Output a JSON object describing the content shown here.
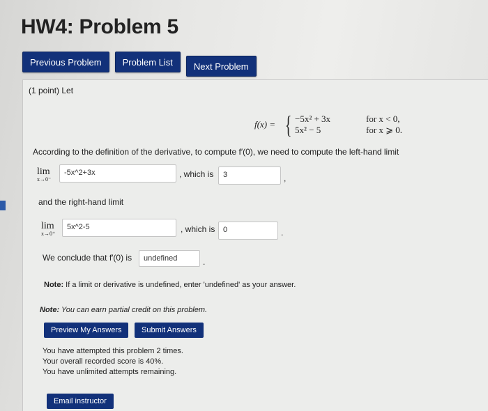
{
  "header": {
    "title": "HW4: Problem 5"
  },
  "nav": {
    "previous": "Previous Problem",
    "list": "Problem List",
    "next": "Next Problem"
  },
  "problem": {
    "points_label": "(1 point) Let",
    "function": {
      "lhs": "f(x) =",
      "piece1": "−5x² + 3x",
      "cond1": "for x < 0,",
      "piece2": "5x² − 5",
      "cond2": "for x ⩾ 0."
    },
    "instruction": "According to the definition of the derivative, to compute f′(0), we need to compute the left-hand limit",
    "left_limit": {
      "word": "lim",
      "sub": "x→0⁻",
      "answer": "-5x^2+3x",
      "which_is": ", which is",
      "value": "3",
      "trail": ","
    },
    "right_intro": "and the right-hand limit",
    "right_limit": {
      "word": "lim",
      "sub": "x→0⁺",
      "answer": "5x^2-5",
      "which_is": ", which is",
      "value": "0",
      "trail": "."
    },
    "conclude": {
      "text": "We conclude that f′(0) is",
      "value": "undefined",
      "trail": "."
    },
    "note": {
      "label": "Note:",
      "text": "If a limit or derivative is undefined, enter 'undefined' as your answer."
    }
  },
  "partial": {
    "label": "Note:",
    "text": "You can earn partial credit on this problem."
  },
  "actions": {
    "preview": "Preview My Answers",
    "submit": "Submit Answers"
  },
  "status": {
    "line1": "You have attempted this problem 2 times.",
    "line2": "Your overall recorded score is 40%.",
    "line3": "You have unlimited attempts remaining."
  },
  "email": {
    "label": "Email instructor"
  },
  "colors": {
    "button_bg": "#12317a",
    "accent_marker": "#2c5aa8"
  }
}
